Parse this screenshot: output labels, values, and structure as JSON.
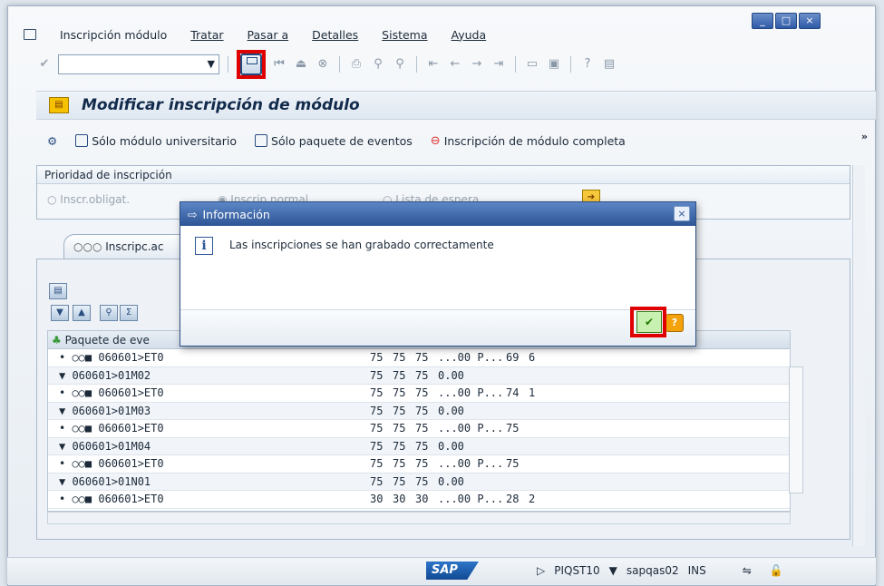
{
  "menu": {
    "items": [
      "Inscripción módulo",
      "Tratar",
      "Pasar a",
      "Detalles",
      "Sistema",
      "Ayuda"
    ]
  },
  "window_controls": {
    "minimize": "_",
    "maximize": "□",
    "close": "×"
  },
  "toolbar": {
    "command_placeholder": "",
    "save_label": "Grabar"
  },
  "title": {
    "text": "Modificar inscripción de módulo"
  },
  "app_toolbar": {
    "btn1": "Sólo módulo universitario",
    "btn2": "Sólo paquete de eventos",
    "btn3": "Inscripción de módulo completa",
    "more": "»"
  },
  "group": {
    "title": "Prioridad de inscripción",
    "opt1": "Inscr.obligat.",
    "opt2": "Inscrip.normal",
    "opt3": "Lista de espera"
  },
  "tab": {
    "label": "Inscripc.ac"
  },
  "grid": {
    "header": "Paquete de eve",
    "rows": [
      {
        "tree": "• ○○■ 060601>ET0",
        "a": "75",
        "b": "75",
        "c": "75",
        "d": "...00 P...",
        "e": "69",
        "f": "6"
      },
      {
        "tree": "▼ 060601>01M02",
        "a": "75",
        "b": "75",
        "c": "75",
        "d": "0.00",
        "e": "",
        "f": ""
      },
      {
        "tree": "• ○○■ 060601>ET0",
        "a": "75",
        "b": "75",
        "c": "75",
        "d": "...00 P...",
        "e": "74",
        "f": "1"
      },
      {
        "tree": "▼ 060601>01M03",
        "a": "75",
        "b": "75",
        "c": "75",
        "d": "0.00",
        "e": "",
        "f": ""
      },
      {
        "tree": "• ○○■ 060601>ET0",
        "a": "75",
        "b": "75",
        "c": "75",
        "d": "...00 P...",
        "e": "75",
        "f": ""
      },
      {
        "tree": "▼ 060601>01M04",
        "a": "75",
        "b": "75",
        "c": "75",
        "d": "0.00",
        "e": "",
        "f": ""
      },
      {
        "tree": "• ○○■ 060601>ET0",
        "a": "75",
        "b": "75",
        "c": "75",
        "d": "...00 P...",
        "e": "75",
        "f": ""
      },
      {
        "tree": "▼ 060601>01N01",
        "a": "75",
        "b": "75",
        "c": "75",
        "d": "0.00",
        "e": "",
        "f": ""
      },
      {
        "tree": "• ○○■ 060601>ET0",
        "a": "30",
        "b": "30",
        "c": "30",
        "d": "...00 P...",
        "e": "28",
        "f": "2"
      }
    ]
  },
  "dialog": {
    "title": "Información",
    "message": "Las inscripciones se han grabado correctamente",
    "ok": "✔",
    "help": "?"
  },
  "status": {
    "logo": "SAP",
    "system": "PIQST10",
    "server": "sapqas02",
    "mode": "INS"
  }
}
